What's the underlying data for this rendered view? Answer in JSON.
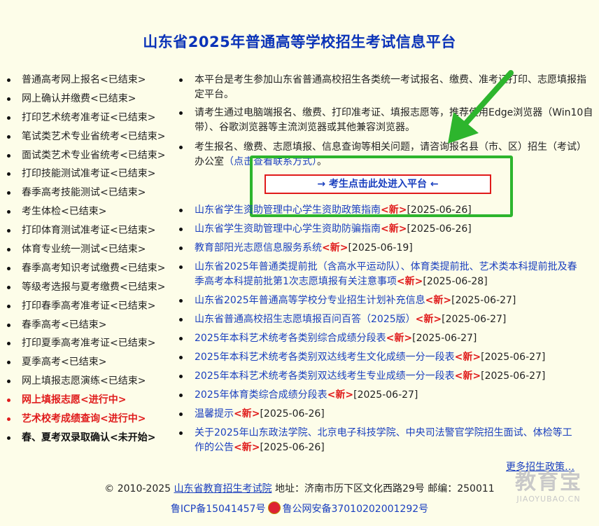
{
  "page": {
    "title": "山东省2025年普通高等学校招生考试信息平台"
  },
  "sidebar": {
    "items": [
      {
        "label": "普通高考网上报名<已结束>",
        "state": "ended"
      },
      {
        "label": "网上确认并缴费<已结束>",
        "state": "ended"
      },
      {
        "label": "打印艺术统考准考证<已结束>",
        "state": "ended"
      },
      {
        "label": "笔试类艺术专业省统考<已结束>",
        "state": "ended"
      },
      {
        "label": "面试类艺术专业省统考<已结束>",
        "state": "ended"
      },
      {
        "label": "打印技能测试准考证<已结束>",
        "state": "ended"
      },
      {
        "label": "春季高考技能测试<已结束>",
        "state": "ended"
      },
      {
        "label": "考生体检<已结束>",
        "state": "ended"
      },
      {
        "label": "打印体育测试准考证<已结束>",
        "state": "ended"
      },
      {
        "label": "体育专业统一测试<已结束>",
        "state": "ended"
      },
      {
        "label": "春季高考知识考试缴费<已结束>",
        "state": "ended"
      },
      {
        "label": "等级考选报与夏考缴费<已结束>",
        "state": "ended"
      },
      {
        "label": "打印春季高考准考证<已结束>",
        "state": "ended"
      },
      {
        "label": "春季高考<已结束>",
        "state": "ended"
      },
      {
        "label": "打印夏季高考准考证<已结束>",
        "state": "ended"
      },
      {
        "label": "夏季高考<已结束>",
        "state": "ended"
      },
      {
        "label": "网上填报志愿演练<已结束>",
        "state": "ended"
      },
      {
        "label": "网上填报志愿<进行中>",
        "state": "active"
      },
      {
        "label": "艺术校考成绩查询<进行中>",
        "state": "active"
      },
      {
        "label": "春、夏考双录取确认<未开始>",
        "state": "pending"
      }
    ]
  },
  "notices": {
    "n1": "本平台是考生参加山东省普通高校招生各类统一考试报名、缴费、准考证打印、志愿填报指定平台。",
    "n2": "请考生通过电脑端报名、缴费、打印准考证、填报志愿等，推荐使用Edge浏览器（Win10自带）、谷歌浏览器等主流浏览器或其他兼容浏览器。",
    "n3_prefix": "考生报名、缴费、志愿填报、信息查询等相关问题，请咨询报名县（市、区）招生（考试）办公室",
    "n3_link": "（点击查看联系方式）",
    "n3_suffix": "。"
  },
  "enter_button": {
    "label": "→ 考生点击此处进入平台 ←"
  },
  "news": [
    {
      "title": "山东省学生资助管理中心学生资助政策指南",
      "badge": "<新>",
      "date": "[2025-06-26]"
    },
    {
      "title": "山东省学生资助管理中心学生资助防骗指南",
      "badge": "<新>",
      "date": "[2025-06-26]"
    },
    {
      "title": "教育部阳光志愿信息服务系统",
      "badge": "<新>",
      "date": "[2025-06-19]"
    },
    {
      "title": "山东省2025年普通类提前批（含高水平运动队）、体育类提前批、艺术类本科提前批及春季高考本科提前批第1次志愿填报有关注意事项",
      "badge": "<新>",
      "date": "[2025-06-28]"
    },
    {
      "title": "山东省2025年普通高等学校分专业招生计划补充信息",
      "badge": "<新>",
      "date": "[2025-06-27]"
    },
    {
      "title": "山东省普通高校招生志愿填报百问百答（2025版）",
      "badge": "<新>",
      "date": "[2025-06-27]"
    },
    {
      "title": "2025年本科艺术统考各类别综合成绩分段表",
      "badge": "<新>",
      "date": "[2025-06-27]"
    },
    {
      "title": "2025年本科艺术统考各类别双达线考生文化成绩一分一段表",
      "badge": "<新>",
      "date": "[2025-06-27]"
    },
    {
      "title": "2025年本科艺术统考各类别双达线考生专业成绩一分一段表",
      "badge": "<新>",
      "date": "[2025-06-27]"
    },
    {
      "title": "2025年体育类综合成绩分段表",
      "badge": "<新>",
      "date": "[2025-06-27]"
    },
    {
      "title": "温馨提示",
      "badge": "<新>",
      "date": "[2025-06-26]"
    },
    {
      "title": "关于2025年山东政法学院、北京电子科技学院、中央司法警官学院招生面试、体检等工作的公告",
      "badge": "<新>",
      "date": "[2025-06-26]"
    }
  ],
  "more_link": "更多招生政策…",
  "footer": {
    "copyright": "© 2010-2025 ",
    "org_link": "山东省教育招生考试院",
    "address": " 地址：济南市历下区文化西路29号 邮编：250011",
    "icp": "鲁ICP备15041457号",
    "police": "鲁公网安备37010202001292号"
  },
  "watermark": {
    "line1": "教育宝",
    "line2": "JIAOYUBAO.CN"
  },
  "colors": {
    "background": "#fdfde9",
    "title": "#0b33b8",
    "link": "#1a3fbf",
    "alert": "#e01b1b",
    "highlight": "#2db52d"
  }
}
